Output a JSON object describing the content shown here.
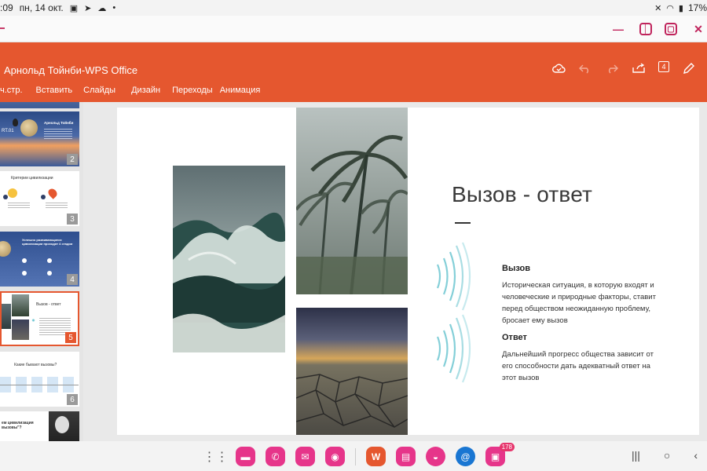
{
  "status_bar": {
    "time": ":09",
    "date": "пн, 14 окт.",
    "battery": "17%"
  },
  "header": {
    "doc_title": "Арнольд Тойнби-WPS Office",
    "menu": [
      "ч.стр.",
      "Вставить",
      "Слайды",
      "Дизайн",
      "Переходы",
      "Анимация"
    ]
  },
  "sidebar": {
    "slides": [
      {
        "num": "2",
        "title": "Арнольд Тойнби",
        "subtitle": "RT.01"
      },
      {
        "num": "3",
        "title": "Критерии цивилизации"
      },
      {
        "num": "4",
        "title": "Успешно развивающиеся цивилизации проходят 4 стадии"
      },
      {
        "num": "5",
        "title": "Вызов - ответ"
      },
      {
        "num": "6",
        "title": "Какие бывают вызовы?"
      },
      {
        "num": "",
        "title": "ем цивилизация вызовы\"?"
      }
    ]
  },
  "slide": {
    "title": "Вызов - ответ",
    "block1": {
      "heading": "Вызов",
      "text": "Историческая ситуация, в которую входят и человеческие и природные факторы, ставит перед обществом неожиданную проблему, бросает ему вызов"
    },
    "block2": {
      "heading": "Ответ",
      "text": "Дальнейший прогресс общества зависит от его способности дать адекватный ответ на этот вызов"
    }
  },
  "taskbar": {
    "mail_badge": "178"
  },
  "colors": {
    "accent": "#e5572f",
    "wave": "#6fc7d2"
  }
}
